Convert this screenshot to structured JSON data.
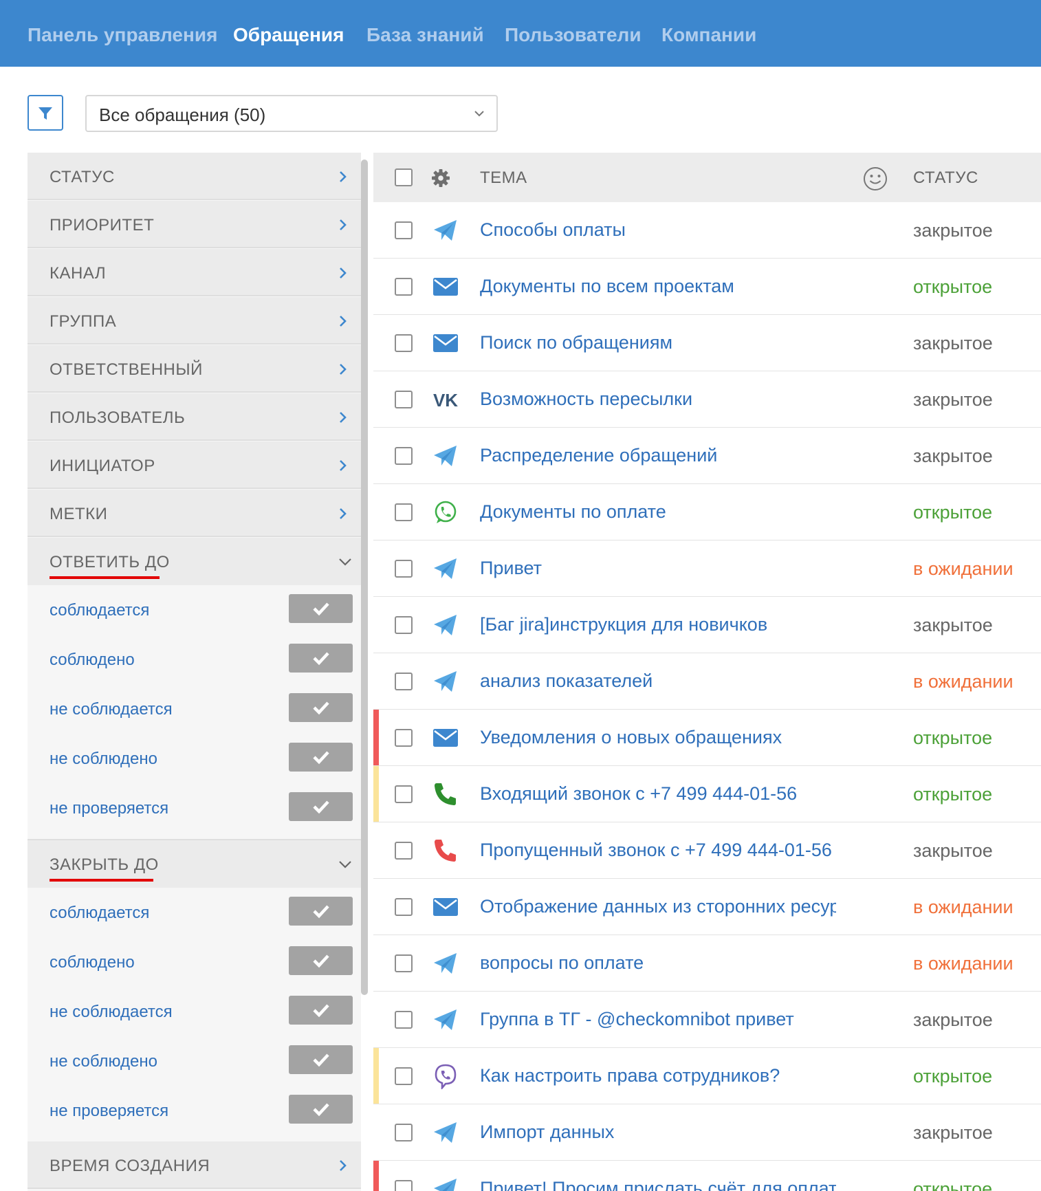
{
  "nav": {
    "items": [
      "Панель управления",
      "Обращения",
      "База знаний",
      "Пользователи",
      "Компании"
    ],
    "active_index": 1
  },
  "toolbar": {
    "filter_icon": "filter-icon",
    "view_select_value": "Все обращения (50)"
  },
  "sidebar": {
    "collapsed_groups": [
      "СТАТУС",
      "ПРИОРИТЕТ",
      "КАНАЛ",
      "ГРУППА",
      "ОТВЕТСТВЕННЫЙ",
      "ПОЛЬЗОВАТЕЛЬ",
      "ИНИЦИАТОР",
      "МЕТКИ"
    ],
    "reply_by": {
      "label": "ОТВЕТИТЬ ДО",
      "options": [
        "соблюдается",
        "соблюдено",
        "не соблюдается",
        "не соблюдено",
        "не проверяется"
      ]
    },
    "close_by": {
      "label": "ЗАКРЫТЬ ДО",
      "options": [
        "соблюдается",
        "соблюдено",
        "не соблюдается",
        "не соблюдено",
        "не проверяется"
      ]
    },
    "created_time": "ВРЕМЯ СОЗДАНИЯ"
  },
  "table": {
    "headers": {
      "subject": "ТЕМА",
      "status": "СТАТУС"
    },
    "rows": [
      {
        "channel": "telegram",
        "subject": "Способы оплаты",
        "status": "закрытое"
      },
      {
        "channel": "email",
        "subject": "Документы по всем проектам",
        "status": "открытое"
      },
      {
        "channel": "email",
        "subject": "Поиск по обращениям",
        "status": "закрытое"
      },
      {
        "channel": "vk",
        "subject": "Возможность пересылки",
        "status": "закрытое"
      },
      {
        "channel": "telegram",
        "subject": "Распределение обращений",
        "status": "закрытое"
      },
      {
        "channel": "whatsapp",
        "subject": "Документы по оплате",
        "status": "открытое"
      },
      {
        "channel": "telegram",
        "subject": "Привет",
        "status": "в ожидании"
      },
      {
        "channel": "telegram",
        "subject": "[Баг jira]инструкция для новичков",
        "status": "закрытое"
      },
      {
        "channel": "telegram",
        "subject": "анализ показателей",
        "status": "в ожидании"
      },
      {
        "channel": "email",
        "subject": "Уведомления о новых обращениях",
        "status": "открытое",
        "priority": "high"
      },
      {
        "channel": "phone-incoming",
        "subject": "Входящий звонок с +7 499 444-01-56",
        "status": "открытое",
        "priority": "medium"
      },
      {
        "channel": "phone-missed",
        "subject": "Пропущенный звонок с +7 499 444-01-56",
        "status": "закрытое"
      },
      {
        "channel": "email",
        "subject": "Отображение данных из сторонних ресурсов",
        "status": "в ожидании"
      },
      {
        "channel": "telegram",
        "subject": "вопросы по оплате",
        "status": "в ожидании"
      },
      {
        "channel": "telegram",
        "subject": "Группа в ТГ - @checkomnibot привет",
        "status": "закрытое"
      },
      {
        "channel": "viber",
        "subject": "Как настроить права сотрудников?",
        "status": "открытое",
        "priority": "medium"
      },
      {
        "channel": "telegram",
        "subject": "Импорт данных",
        "status": "закрытое"
      },
      {
        "channel": "telegram",
        "subject": "Привет! Просим прислать счёт для оплаты",
        "status": "открытое",
        "priority": "high"
      }
    ]
  },
  "colors": {
    "brand": "#3d87ce",
    "link": "#2f6fba",
    "status_closed": "#666666",
    "status_open": "#4ca138",
    "status_pending": "#f0703a",
    "priority_high": "#f05a5a",
    "priority_medium": "#fbe49a"
  }
}
